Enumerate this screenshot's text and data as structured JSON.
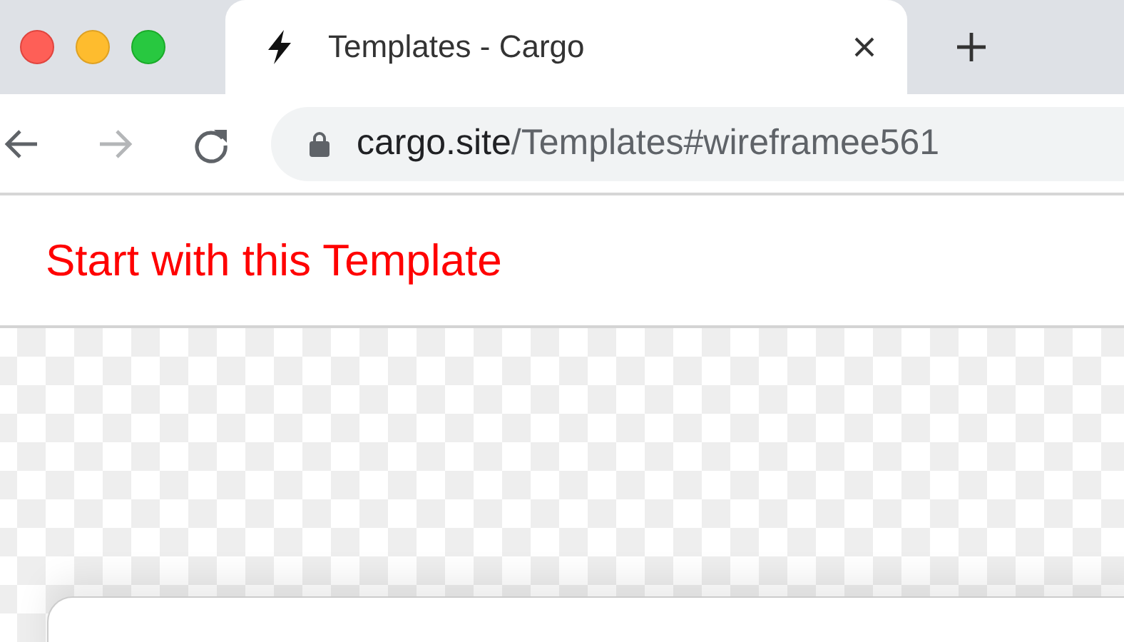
{
  "tabs": [
    {
      "title": "Templates - Cargo",
      "selected": true
    }
  ],
  "nav_buttons": [
    {
      "kind": "back",
      "disabled": false
    },
    {
      "kind": "forward",
      "disabled": true
    },
    {
      "kind": "reload",
      "disabled": false
    }
  ],
  "address_bar": {
    "host": "cargo.site",
    "path": "/Templates#wireframee561"
  },
  "page": {
    "header_link": "Start with this Template"
  }
}
